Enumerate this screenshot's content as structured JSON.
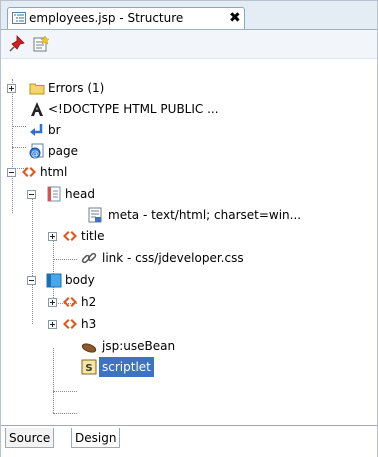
{
  "tab": {
    "title": "employees.jsp - Structure",
    "close": "✖"
  },
  "toolbar": {
    "buttons": [
      "pin-icon",
      "new-view-icon"
    ]
  },
  "tree": {
    "errors": "Errors (1)",
    "doctype": "<!DOCTYPE HTML PUBLIC ...",
    "br": "br",
    "page": "page",
    "html": "html",
    "head": "head",
    "meta": "meta - text/html; charset=win...",
    "title": "title",
    "link": "link - css/jdeveloper.css",
    "body": "body",
    "h2": "h2",
    "h3": "h3",
    "usebean": "jsp:useBean",
    "scriptlet": "scriptlet"
  },
  "bottom_tabs": {
    "source": "Source",
    "design": "Design"
  },
  "colors": {
    "selection": "#3d73c2",
    "tag": "#e2571e",
    "folder": "#f5d46b"
  }
}
